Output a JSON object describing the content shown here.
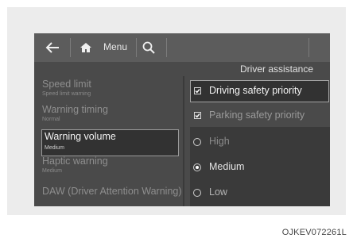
{
  "toolbar": {
    "back_icon": "arrow-left-icon",
    "home_icon": "home-icon",
    "menu_label": "Menu",
    "search_icon": "search-icon"
  },
  "header": {
    "title": "Driver assistance"
  },
  "left_menu": [
    {
      "title": "Speed limit",
      "subtitle": "Speed limit warning",
      "selected": false
    },
    {
      "title": "Warning timing",
      "subtitle": "Normal",
      "selected": false
    },
    {
      "title": "Warning volume",
      "subtitle": "Medium",
      "selected": true
    },
    {
      "title": "Haptic warning",
      "subtitle": "Medium",
      "selected": false
    },
    {
      "title": "DAW (Driver Attention Warning)",
      "subtitle": "",
      "selected": false
    }
  ],
  "options": {
    "driving_safety_priority": {
      "label": "Driving safety priority",
      "checked": true
    },
    "parking_safety_priority": {
      "label": "Parking safety priority",
      "checked": true
    },
    "volume_levels": [
      {
        "label": "High",
        "selected": false
      },
      {
        "label": "Medium",
        "selected": true
      },
      {
        "label": "Low",
        "selected": false
      }
    ]
  },
  "figure_code": "OJKEV072261L",
  "colors": {
    "screen_bg": "#4a4a4a",
    "toolbar_bg": "#5c5c5c",
    "selected_bg": "#323232"
  }
}
